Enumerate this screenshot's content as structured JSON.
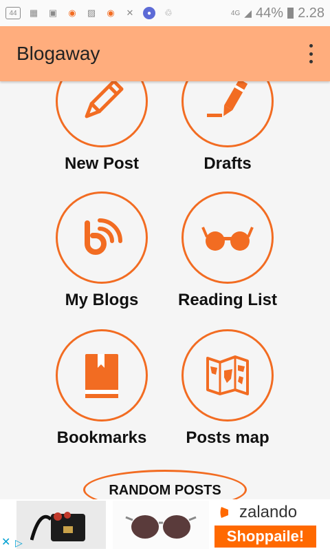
{
  "status_bar": {
    "network": "4G",
    "battery": "44%",
    "time": "2.28",
    "notif_badge": "44"
  },
  "app": {
    "title": "Blogaway"
  },
  "tiles": [
    {
      "label": "New Post",
      "icon": "pencil-icon"
    },
    {
      "label": "Drafts",
      "icon": "draft-pencil-icon"
    },
    {
      "label": "My Blogs",
      "icon": "blogger-icon"
    },
    {
      "label": "Reading List",
      "icon": "glasses-icon"
    },
    {
      "label": "Bookmarks",
      "icon": "bookmark-book-icon"
    },
    {
      "label": "Posts map",
      "icon": "map-icon"
    }
  ],
  "random_posts_label": "RANDOM POSTS",
  "ad": {
    "brand": "zalando",
    "cta": "Shoppaile!"
  },
  "colors": {
    "accent": "#f26c22",
    "appbar": "#ffad7d",
    "ad_cta": "#ff6900"
  }
}
